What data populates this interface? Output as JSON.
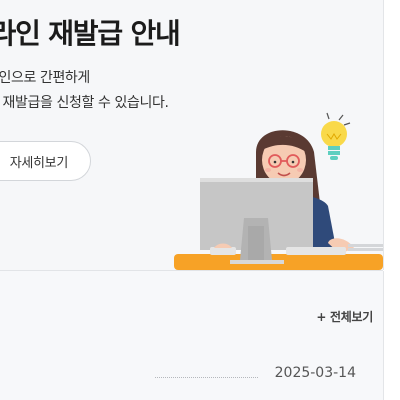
{
  "banner": {
    "title": "온라인 재발급 안내",
    "desc_line1": "라인으로 간편하게",
    "desc_line2": "편 재발급을 신청할 수 있습니다.",
    "more_button": "자세히보기"
  },
  "board": {
    "view_all": "+ 전체보기",
    "rows": [
      {
        "date": "2025-03-14"
      }
    ]
  },
  "colors": {
    "banner_bg": "#f6f7f9",
    "desk_orange": "#f7a226",
    "bulb_yellow": "#f9d94a",
    "sweater_blue": "#2f4a7a"
  },
  "icons": [
    "lightbulb-icon"
  ]
}
